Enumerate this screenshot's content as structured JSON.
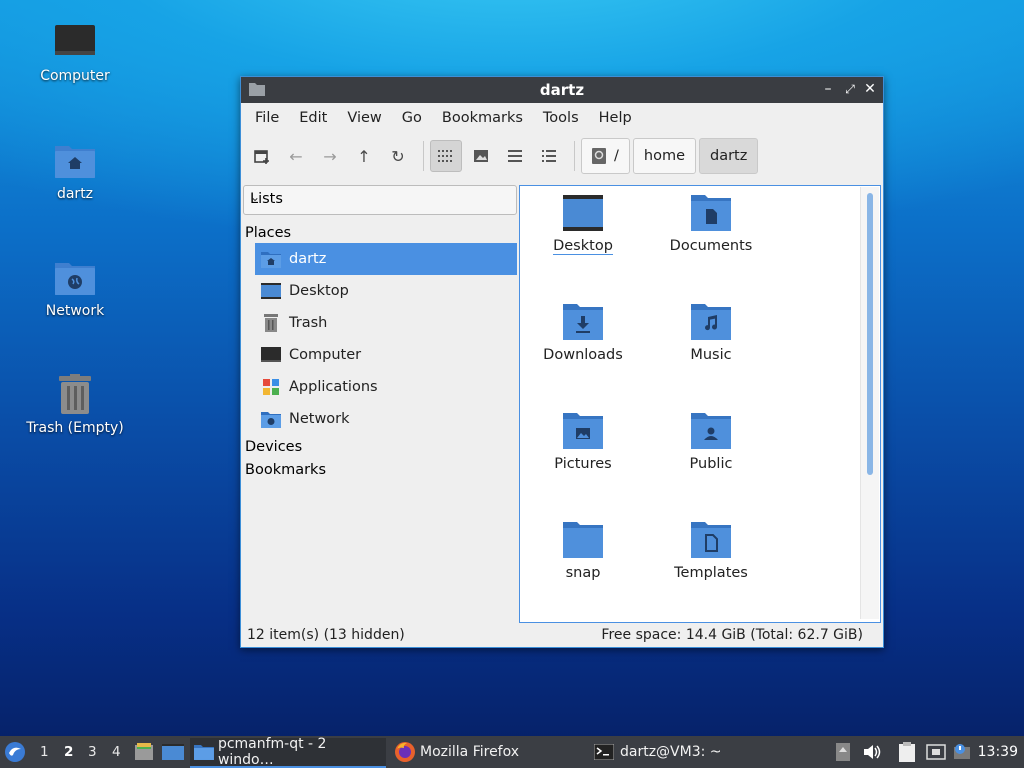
{
  "desktop": {
    "icons": [
      {
        "label": "Computer"
      },
      {
        "label": "dartz"
      },
      {
        "label": "Network"
      },
      {
        "label": "Trash (Empty)"
      }
    ]
  },
  "window": {
    "title": "dartz",
    "menu": [
      "File",
      "Edit",
      "View",
      "Go",
      "Bookmarks",
      "Tools",
      "Help"
    ],
    "breadcrumb": [
      "/",
      "home",
      "dartz"
    ],
    "sidebar": {
      "view_select": "Lists",
      "places_heading": "Places",
      "places": [
        {
          "label": "dartz",
          "selected": true
        },
        {
          "label": "Desktop"
        },
        {
          "label": "Trash"
        },
        {
          "label": "Computer"
        },
        {
          "label": "Applications"
        },
        {
          "label": "Network"
        }
      ],
      "devices_heading": "Devices",
      "bookmarks_heading": "Bookmarks"
    },
    "files": [
      {
        "label": "Desktop",
        "icon": "desktop-folder-icon"
      },
      {
        "label": "Documents",
        "icon": "documents-folder-icon"
      },
      {
        "label": "Downloads",
        "icon": "downloads-folder-icon"
      },
      {
        "label": "Music",
        "icon": "music-folder-icon"
      },
      {
        "label": "Pictures",
        "icon": "pictures-folder-icon"
      },
      {
        "label": "Public",
        "icon": "public-folder-icon"
      },
      {
        "label": "snap",
        "icon": "folder-icon"
      },
      {
        "label": "Templates",
        "icon": "templates-folder-icon"
      }
    ],
    "status_left": "12 item(s) (13 hidden)",
    "status_right": "Free space: 14.4 GiB (Total: 62.7 GiB)"
  },
  "taskbar": {
    "desktops": [
      "1",
      "2",
      "3",
      "4"
    ],
    "current_desktop": "2",
    "tasks": [
      {
        "label": "pcmanfm-qt - 2 windo…",
        "active": true
      },
      {
        "label": "Mozilla Firefox"
      },
      {
        "label": "dartz@VM3: ~"
      }
    ],
    "clock": "13:39"
  },
  "colors": {
    "accent": "#4a90e2",
    "folder": "#4a8ad4",
    "titlebar": "#3a3d42"
  }
}
